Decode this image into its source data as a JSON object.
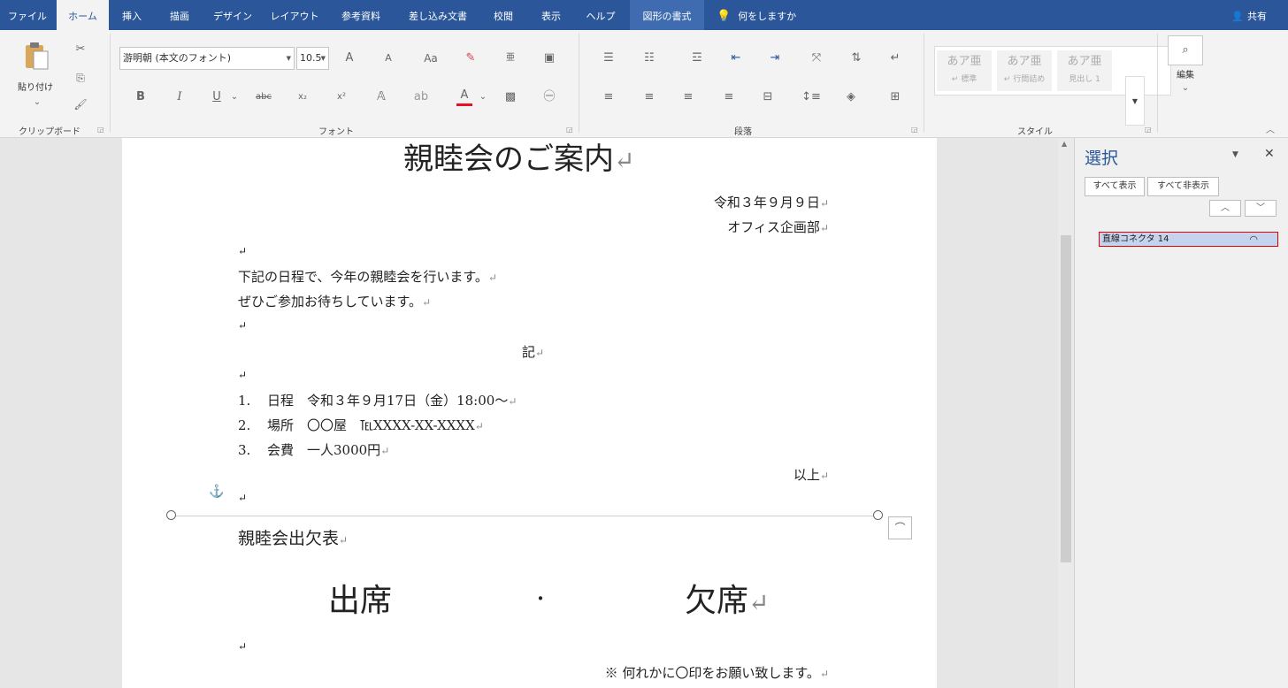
{
  "tabs": [
    {
      "label": "ファイル"
    },
    {
      "label": "ホーム"
    },
    {
      "label": "挿入"
    },
    {
      "label": "描画"
    },
    {
      "label": "デザイン"
    },
    {
      "label": "レイアウト"
    },
    {
      "label": "参考資料"
    },
    {
      "label": "差し込み文書"
    },
    {
      "label": "校閲"
    },
    {
      "label": "表示"
    },
    {
      "label": "ヘルプ"
    },
    {
      "label": "図形の書式"
    }
  ],
  "tell_me": "何をしますか",
  "share": "共有",
  "ribbon": {
    "clipboard": {
      "paste_label": "貼り付け",
      "group_label": "クリップボード"
    },
    "font": {
      "font_name": "游明朝 (本文のフォント)",
      "font_size": "10.5",
      "group_label": "フォント",
      "grow_font": "A",
      "shrink_font": "A",
      "change_case": "Aa",
      "bold": "B",
      "italic": "I",
      "underline": "U",
      "strike": "abc",
      "subscript": "x₂",
      "superscript": "x²",
      "font_color": "A",
      "font_color_value": "#e81123"
    },
    "paragraph": {
      "group_label": "段落"
    },
    "styles": {
      "group_label": "スタイル",
      "items": [
        {
          "preview": "あア亜",
          "name": "↵ 標準"
        },
        {
          "preview": "あア亜",
          "name": "↵ 行間詰め"
        },
        {
          "preview": "あア亜",
          "name": "見出し 1"
        }
      ]
    },
    "editing": {
      "label": "編集"
    }
  },
  "document": {
    "title": "親睦会のご案内",
    "date": "令和３年９月９日",
    "sender": "オフィス企画部",
    "body_line1": "下記の日程で、今年の親睦会を行います。",
    "body_line2": "ぜひご参加お待ちしています。",
    "ki": "記",
    "items": [
      {
        "num": "1.",
        "text": "日程　令和３年９月17日（金）18:00～"
      },
      {
        "num": "2.",
        "text": "場所　〇〇屋　℡XXXX-XX-XXXX"
      },
      {
        "num": "3.",
        "text": "会費　一人3000円"
      }
    ],
    "ijou": "以上",
    "attendance_title": "親睦会出欠表",
    "attend": "出席",
    "dot": "・",
    "absent": "欠席",
    "note": "※ 何れかに〇印をお願い致します。"
  },
  "selection_pane": {
    "title": "選択",
    "show_all": "すべて表示",
    "hide_all": "すべて非表示",
    "items": [
      {
        "name": "直線コネクタ 14"
      }
    ]
  },
  "colors": {
    "accent": "#2b579a",
    "selection_border": "#e00000",
    "selection_fill": "#c5d3ee"
  }
}
